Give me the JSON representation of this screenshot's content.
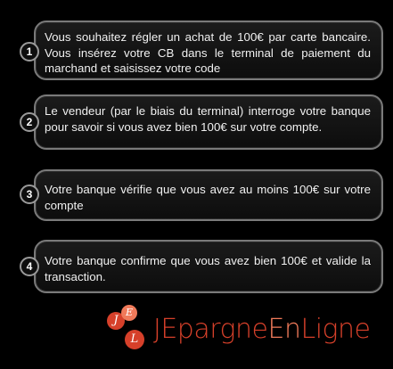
{
  "steps": [
    {
      "number": "1",
      "text": "Vous souhaitez régler un achat de 100€ par carte bancaire. Vous insérez votre CB dans le terminal de paiement du marchand et saisissez votre code"
    },
    {
      "number": "2",
      "text": "Le vendeur (par le biais du terminal) interroge votre banque pour savoir si vous avez bien 100€ sur votre compte."
    },
    {
      "number": "3",
      "text": "Votre banque vérifie que vous avez au moins 100€ sur votre compte"
    },
    {
      "number": "4",
      "text": "Votre banque confirme que vous avez bien 100€ et valide la transaction."
    }
  ],
  "logo": {
    "letters": [
      "J",
      "E",
      "L"
    ],
    "wordmark": {
      "part1": "JEpargne",
      "part2": "En",
      "part3": "Ligne"
    },
    "colors": {
      "primary": "#d6402a",
      "secondary": "#f07a5a"
    }
  }
}
